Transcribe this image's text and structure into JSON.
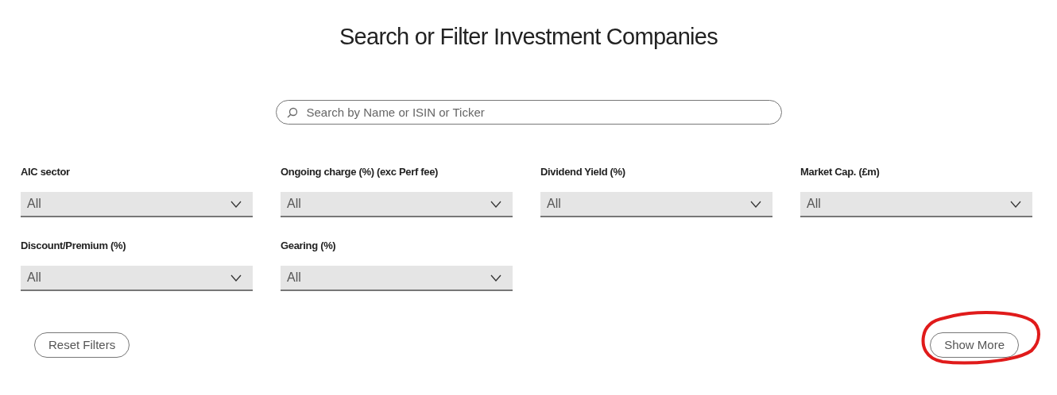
{
  "title": "Search or Filter Investment Companies",
  "search": {
    "placeholder": "Search by Name or ISIN or Ticker"
  },
  "filters": [
    {
      "label": "AIC sector",
      "value": "All"
    },
    {
      "label": "Ongoing charge (%) (exc Perf fee)",
      "value": "All"
    },
    {
      "label": "Dividend Yield (%)",
      "value": "All"
    },
    {
      "label": "Market Cap. (£m)",
      "value": "All"
    },
    {
      "label": "Discount/Premium (%)",
      "value": "All"
    },
    {
      "label": "Gearing (%)",
      "value": "All"
    }
  ],
  "buttons": {
    "reset": "Reset Filters",
    "more": "Show More"
  }
}
